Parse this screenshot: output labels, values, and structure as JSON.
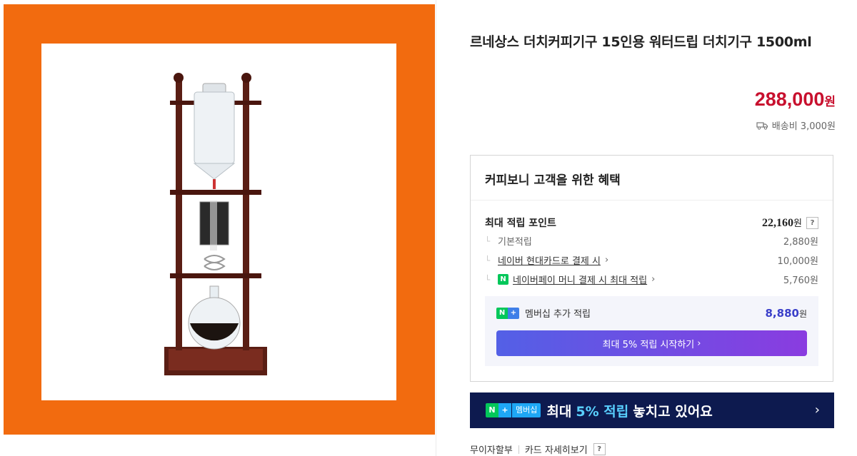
{
  "product": {
    "title": "르네상스 더치커피기구 15인용 워터드립 더치기구 1500ml",
    "price": "288,000",
    "price_unit": "원",
    "shipping": "배송비 3,000원"
  },
  "benefits": {
    "title": "커피보니 고객을 위한 혜택",
    "max_points_label": "최대 적립 포인트",
    "max_points_value": "22,160",
    "max_points_unit": "원",
    "help": "?",
    "rows": [
      {
        "label": "기본적립",
        "value": "2,880원"
      },
      {
        "label": "네이버 현대카드로 결제 시",
        "value": "10,000원"
      },
      {
        "label": "네이버페이 머니 결제 시 최대 적립",
        "value": "5,760원"
      }
    ],
    "membership": {
      "label": "멤버십 추가 적립",
      "value": "8,880",
      "unit": "원",
      "button_label": "최대 5% 적립 시작하기"
    }
  },
  "banner": {
    "badge_n": "N",
    "badge_plus": "+",
    "badge_text": "멤버십",
    "text_pre": "최대",
    "text_highlight": "5% 적립",
    "text_post": "놓치고 있어요"
  },
  "bottom": {
    "installment": "무이자할부",
    "card_details": "카드 자세히보기",
    "help": "?"
  },
  "icons": {
    "shipping": "truck-icon",
    "chevron": "chevron-right-icon",
    "npay": "naver-pay-icon"
  },
  "colors": {
    "brand_orange": "#f26b0f",
    "price_red": "#c8102e",
    "banner_navy": "#0d1a4f",
    "membership_purple": "#3a3fc9"
  }
}
